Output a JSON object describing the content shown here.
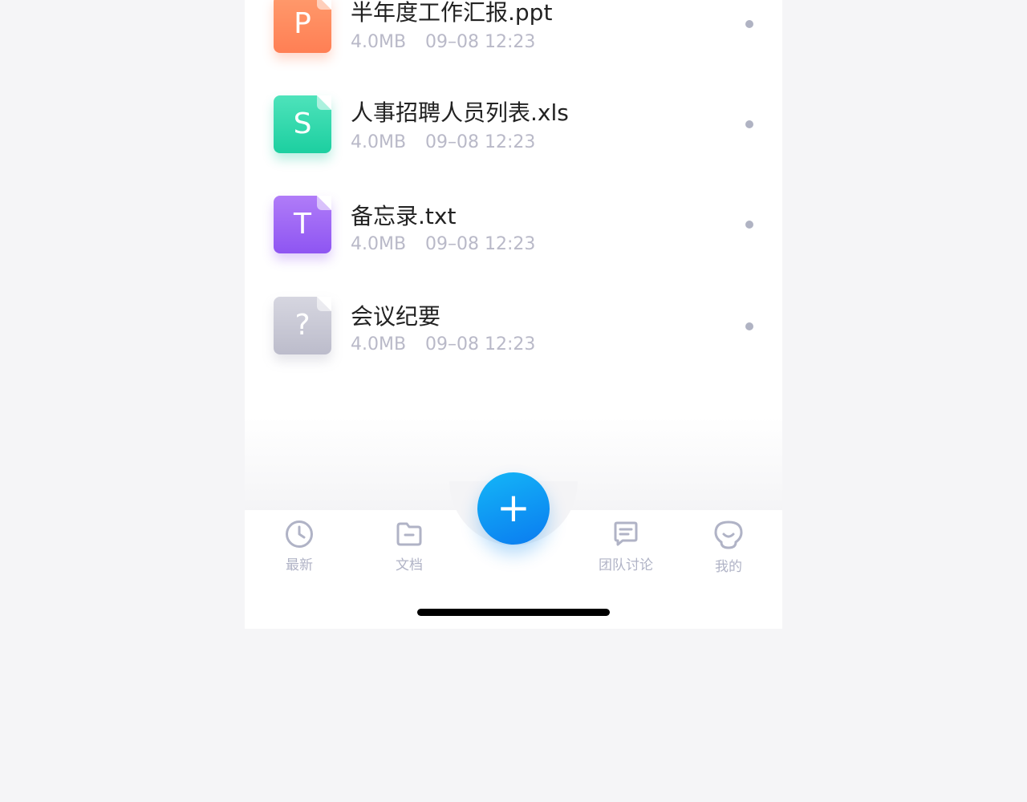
{
  "files": [
    {
      "icon_letter": "P",
      "name": "半年度工作汇报.ppt",
      "size": "4.0MB",
      "date": "09–08 12:23",
      "color": "#ff8a5c",
      "icon": "ppt-file-icon"
    },
    {
      "icon_letter": "S",
      "name": "人事招聘人员列表.xls",
      "size": "4.0MB",
      "date": "09–08 12:23",
      "color": "#25d2a7",
      "icon": "xls-file-icon"
    },
    {
      "icon_letter": "T",
      "name": "备忘录.txt",
      "size": "4.0MB",
      "date": "09–08 12:23",
      "color": "#9b63f4",
      "icon": "txt-file-icon"
    },
    {
      "icon_letter": "?",
      "name": "会议纪要",
      "size": "4.0MB",
      "date": "09–08 12:23",
      "color": "#c6c6d4",
      "icon": "unknown-file-icon"
    }
  ],
  "tabbar": {
    "recent_label": "最新",
    "docs_label": "文档",
    "discuss_label": "团队讨论",
    "mine_label": "我的",
    "add_symbol": "+"
  },
  "colors": {
    "accent": "#0a8ff2",
    "tab_inactive": "#b0b3c6",
    "meta_text": "#b9b9c8"
  }
}
